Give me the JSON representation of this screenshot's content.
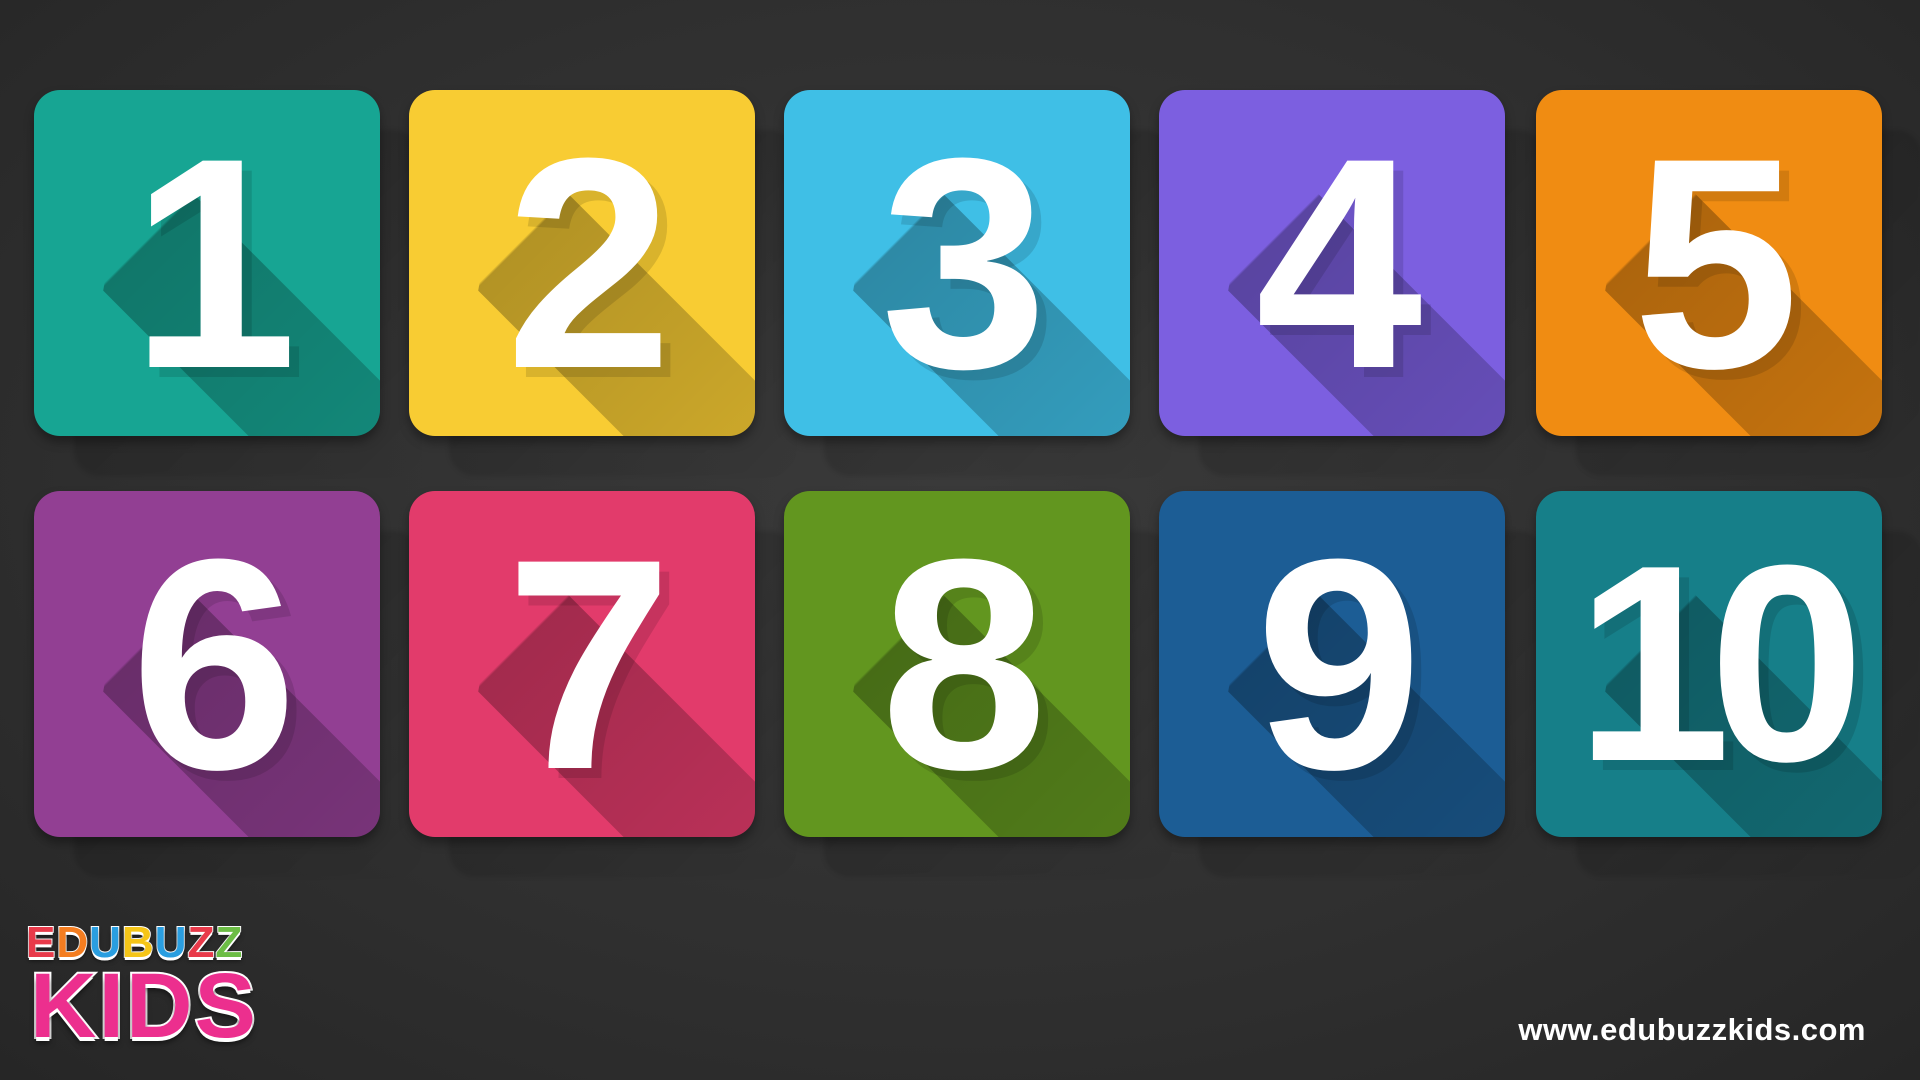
{
  "tiles": [
    {
      "label": "1",
      "color": "#17a593"
    },
    {
      "label": "2",
      "color": "#f8cc33"
    },
    {
      "label": "3",
      "color": "#3fbfe6"
    },
    {
      "label": "4",
      "color": "#7c5fe0"
    },
    {
      "label": "5",
      "color": "#f08c12"
    },
    {
      "label": "6",
      "color": "#923f93"
    },
    {
      "label": "7",
      "color": "#e23b6b"
    },
    {
      "label": "8",
      "color": "#62961f"
    },
    {
      "label": "9",
      "color": "#1c5d95"
    },
    {
      "label": "10",
      "color": "#167f89"
    }
  ],
  "logo": {
    "top_letters": [
      {
        "char": "E",
        "color": "#e83a4a"
      },
      {
        "char": "D",
        "color": "#f47d20"
      },
      {
        "char": "U",
        "color": "#2a9ee0"
      },
      {
        "char": "B",
        "color": "#f5c518"
      },
      {
        "char": "U",
        "color": "#2a9ee0"
      },
      {
        "char": "Z",
        "color": "#e83a4a"
      },
      {
        "char": "Z",
        "color": "#6cbd45"
      }
    ],
    "bottom": "KIDS",
    "bottom_color": "#ec2f8e"
  },
  "website": "www.edubuzzkids.com",
  "background_color": "#333333"
}
